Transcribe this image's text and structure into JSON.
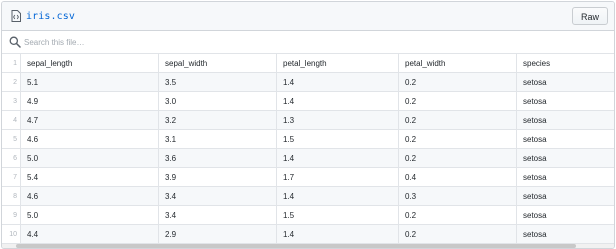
{
  "file": {
    "name": "iris.csv",
    "icon": "file-code-icon",
    "raw_label": "Raw"
  },
  "search": {
    "placeholder": "Search this file…",
    "icon": "search-icon"
  },
  "table": {
    "headers": [
      "sepal_length",
      "sepal_width",
      "petal_length",
      "petal_width",
      "species"
    ],
    "rows": [
      {
        "num": "2",
        "cells": [
          "5.1",
          "3.5",
          "1.4",
          "0.2",
          "setosa"
        ]
      },
      {
        "num": "3",
        "cells": [
          "4.9",
          "3.0",
          "1.4",
          "0.2",
          "setosa"
        ]
      },
      {
        "num": "4",
        "cells": [
          "4.7",
          "3.2",
          "1.3",
          "0.2",
          "setosa"
        ]
      },
      {
        "num": "5",
        "cells": [
          "4.6",
          "3.1",
          "1.5",
          "0.2",
          "setosa"
        ]
      },
      {
        "num": "6",
        "cells": [
          "5.0",
          "3.6",
          "1.4",
          "0.2",
          "setosa"
        ]
      },
      {
        "num": "7",
        "cells": [
          "5.4",
          "3.9",
          "1.7",
          "0.4",
          "setosa"
        ]
      },
      {
        "num": "8",
        "cells": [
          "4.6",
          "3.4",
          "1.4",
          "0.3",
          "setosa"
        ]
      },
      {
        "num": "9",
        "cells": [
          "5.0",
          "3.4",
          "1.5",
          "0.2",
          "setosa"
        ]
      },
      {
        "num": "10",
        "cells": [
          "4.4",
          "2.9",
          "1.4",
          "0.2",
          "setosa"
        ]
      }
    ],
    "header_line_number": "1"
  },
  "colors": {
    "link": "#0366d6",
    "border": "#d1d5da",
    "stripe": "#f6f8fa"
  }
}
